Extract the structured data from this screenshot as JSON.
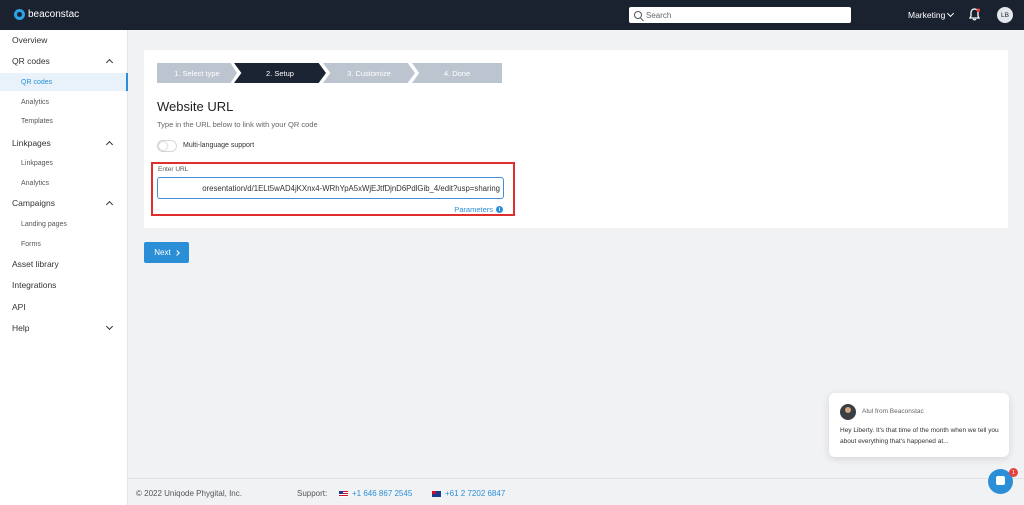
{
  "header": {
    "brand": "beaconstac",
    "search_placeholder": "Search",
    "account_label": "Marketing",
    "avatar_initials": "LB"
  },
  "sidebar": {
    "items": [
      {
        "label": "Overview"
      },
      {
        "label": "QR codes"
      },
      {
        "label": "QR codes"
      },
      {
        "label": "Analytics"
      },
      {
        "label": "Templates"
      },
      {
        "label": "Linkpages"
      },
      {
        "label": "Linkpages"
      },
      {
        "label": "Analytics"
      },
      {
        "label": "Campaigns"
      },
      {
        "label": "Landing pages"
      },
      {
        "label": "Forms"
      },
      {
        "label": "Asset library"
      },
      {
        "label": "Integrations"
      },
      {
        "label": "API"
      },
      {
        "label": "Help"
      }
    ]
  },
  "steps": [
    "1. Select type",
    "2. Setup",
    "3. Customize",
    "4. Done"
  ],
  "main": {
    "title": "Website URL",
    "subtitle": "Type in the URL below to link with your QR code",
    "toggle_label": "Multi-language support",
    "url_label": "Enter URL",
    "url_value": "oresentation/d/1ELt5wAD4jKXnx4-WRhYpA5xWjEJtfDjnD6PdlGib_4/edit?usp=sharing",
    "params_label": "Parameters",
    "next_label": "Next"
  },
  "footer": {
    "copyright": "© 2022 Uniqode Phygital, Inc.",
    "support_label": "Support:",
    "phone_us": "+1 646 867 2545",
    "phone_au": "+61 2 7202 6847"
  },
  "chat": {
    "from": "Atul from Beaconstac",
    "message": "Hey Liberty. It's that time of the month when we tell you about everything that's happened at...",
    "badge": "1"
  },
  "colors": {
    "accent": "#2a8fd7",
    "topbar": "#1a2230",
    "highlight_border": "#e02d2d"
  }
}
